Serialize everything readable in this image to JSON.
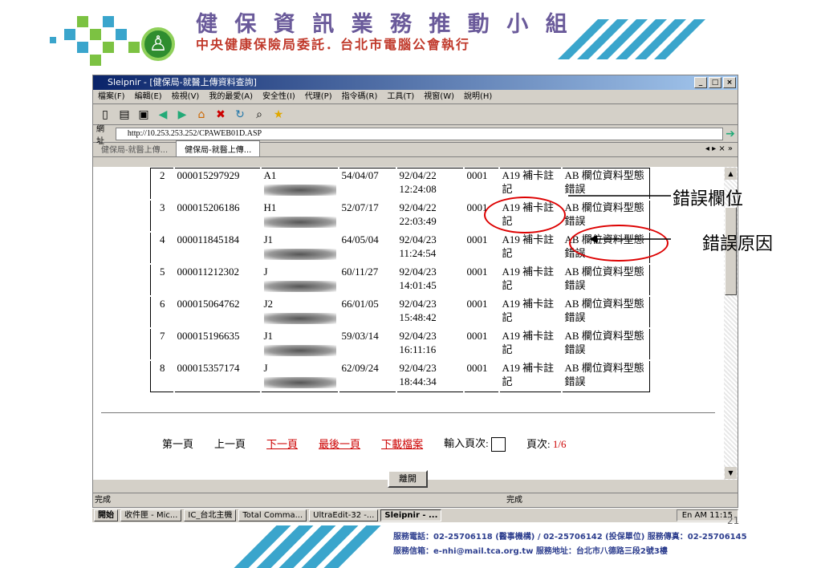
{
  "header": {
    "title": "健 保 資 訊 業 務 推 動 小 組",
    "subtitle": "中央健康保險局委託．台北市電腦公會執行"
  },
  "window": {
    "title": "Sleipnir - [健保局-就醫上傳資料查詢]",
    "menus": [
      "檔案(F)",
      "編輯(E)",
      "檢視(V)",
      "我的最愛(A)",
      "安全性(I)",
      "代理(P)",
      "指令碼(R)",
      "工具(T)",
      "視窗(W)",
      "說明(H)"
    ],
    "address_label": "網址",
    "address_value": "http://10.253.253.252/CPAWEB01D.ASP",
    "tabs": [
      "健保局-就醫上傳...",
      "健保局-就醫上傳..."
    ],
    "status_left": "完成",
    "status_mid": "完成"
  },
  "table": {
    "rows": [
      {
        "no": "2",
        "card": "000015297929",
        "id": "A1",
        "birth": "54/04/07",
        "date": "92/04/22",
        "time": "12:24:08",
        "code": "0001",
        "field": "A19 補卡註記",
        "reason": "AB 欄位資料型態錯誤"
      },
      {
        "no": "3",
        "card": "000015206186",
        "id": "H1",
        "birth": "52/07/17",
        "date": "92/04/22",
        "time": "22:03:49",
        "code": "0001",
        "field": "A19 補卡註記",
        "reason": "AB 欄位資料型態錯誤"
      },
      {
        "no": "4",
        "card": "000011845184",
        "id": "J1",
        "birth": "64/05/04",
        "date": "92/04/23",
        "time": "11:24:54",
        "code": "0001",
        "field": "A19 補卡註記",
        "reason": "AB 欄位資料型態錯誤"
      },
      {
        "no": "5",
        "card": "000011212302",
        "id": "J",
        "birth": "60/11/27",
        "date": "92/04/23",
        "time": "14:01:45",
        "code": "0001",
        "field": "A19 補卡註記",
        "reason": "AB 欄位資料型態錯誤"
      },
      {
        "no": "6",
        "card": "000015064762",
        "id": "J2",
        "birth": "66/01/05",
        "date": "92/04/23",
        "time": "15:48:42",
        "code": "0001",
        "field": "A19 補卡註記",
        "reason": "AB 欄位資料型態錯誤"
      },
      {
        "no": "7",
        "card": "000015196635",
        "id": "J1",
        "birth": "59/03/14",
        "date": "92/04/23",
        "time": "16:11:16",
        "code": "0001",
        "field": "A19 補卡註記",
        "reason": "AB 欄位資料型態錯誤"
      },
      {
        "no": "8",
        "card": "000015357174",
        "id": "J",
        "birth": "62/09/24",
        "date": "92/04/23",
        "time": "18:44:34",
        "code": "0001",
        "field": "A19 補卡註記",
        "reason": "AB 欄位資料型態錯誤"
      }
    ]
  },
  "pager": {
    "first": "第一頁",
    "prev": "上一頁",
    "next": "下一頁",
    "last": "最後一頁",
    "download": "下載檔案",
    "input_label": "輸入頁次:",
    "page_label": "頁次:",
    "page_value": "1/6",
    "close": "離開"
  },
  "taskbar": {
    "start": "開始",
    "items": [
      "收件匣 - Mic...",
      "IC_台北主機",
      "Total Comma...",
      "UltraEdit-32 -...",
      "Sleipnir - ..."
    ],
    "tray": "En  AM 11:15"
  },
  "annotations": {
    "field_label": "錯誤欄位",
    "reason_label": "錯誤原因"
  },
  "footer": {
    "line1": "服務電話：02-25706118 (醫事機構) / 02-25706142 (投保單位)   服務傳真：02-25706145",
    "line2": "服務信箱：e-nhi@mail.tca.org.tw   服務地址：台北市八德路三段2號3樓",
    "page_number": "21"
  },
  "colors": {
    "accent_red": "#d00000",
    "header_purple": "#6a5a9a",
    "stripe_blue": "#3aa5cc"
  }
}
